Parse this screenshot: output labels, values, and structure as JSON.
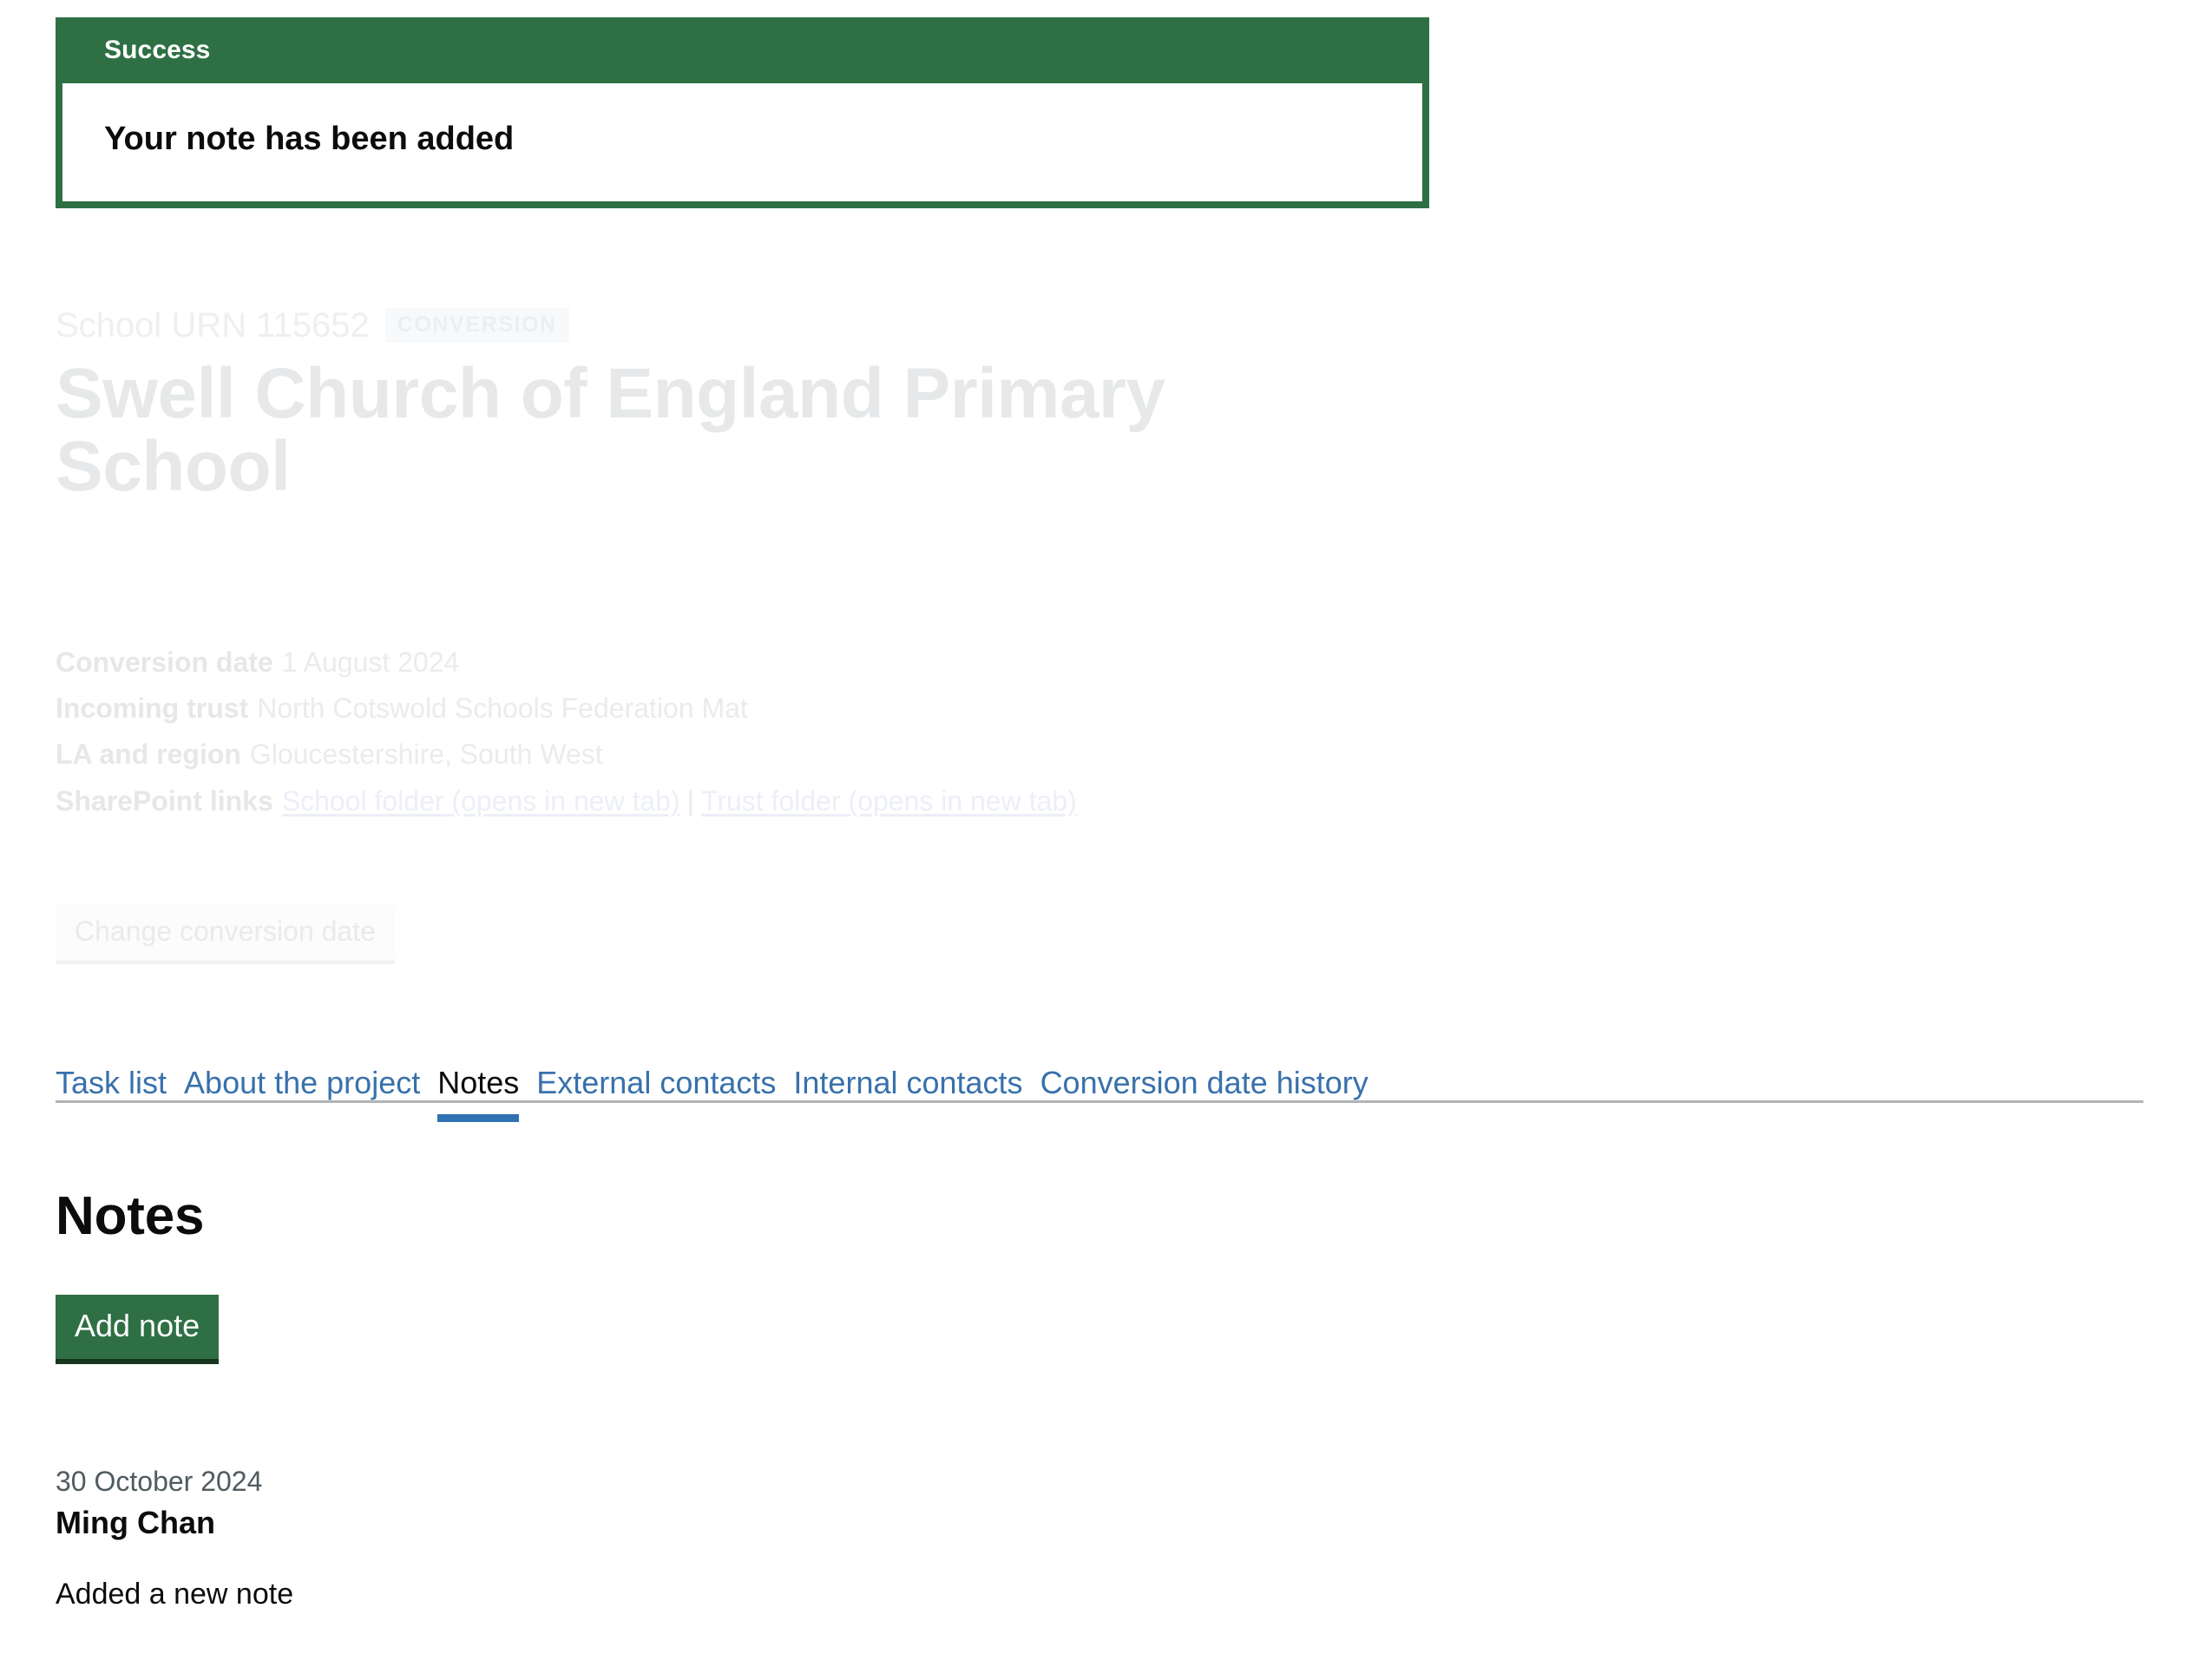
{
  "notification": {
    "title": "Success",
    "message": "Your note has been added",
    "accent_color": "#2e7044"
  },
  "project_header": {
    "caption": "School URN 115652",
    "tag": "CONVERSION",
    "title": "Swell Church of England Primary School"
  },
  "summary": {
    "conversion_date": {
      "label": "Conversion date",
      "value": "1 August 2024"
    },
    "incoming_trust": {
      "label": "Incoming trust",
      "value": "North Cotswold Schools Federation Mat"
    },
    "la_and_region": {
      "label": "LA and region",
      "value": "Gloucestershire, South West"
    },
    "sharepoint_links": {
      "label": "SharePoint links",
      "school_folder": "School folder (opens in new tab)",
      "separator": "|",
      "trust_folder": "Trust folder (opens in new tab)"
    }
  },
  "actions": {
    "change_conversion_date": "Change conversion date"
  },
  "tabs": [
    {
      "label": "Task list",
      "active": false
    },
    {
      "label": "About the project",
      "active": false
    },
    {
      "label": "Notes",
      "active": true
    },
    {
      "label": "External contacts",
      "active": false
    },
    {
      "label": "Internal contacts",
      "active": false
    },
    {
      "label": "Conversion date history",
      "active": false
    }
  ],
  "notes_panel": {
    "heading": "Notes",
    "add_note_label": "Add note",
    "notes": [
      {
        "date": "30 October 2024",
        "author": "Ming Chan",
        "body": "Added a new note"
      }
    ]
  },
  "colors": {
    "green": "#2e7044",
    "link_blue": "#3871ac",
    "tab_underline": "#3072b3",
    "muted_text": "#505a5f",
    "rule": "#b1b4b6"
  }
}
